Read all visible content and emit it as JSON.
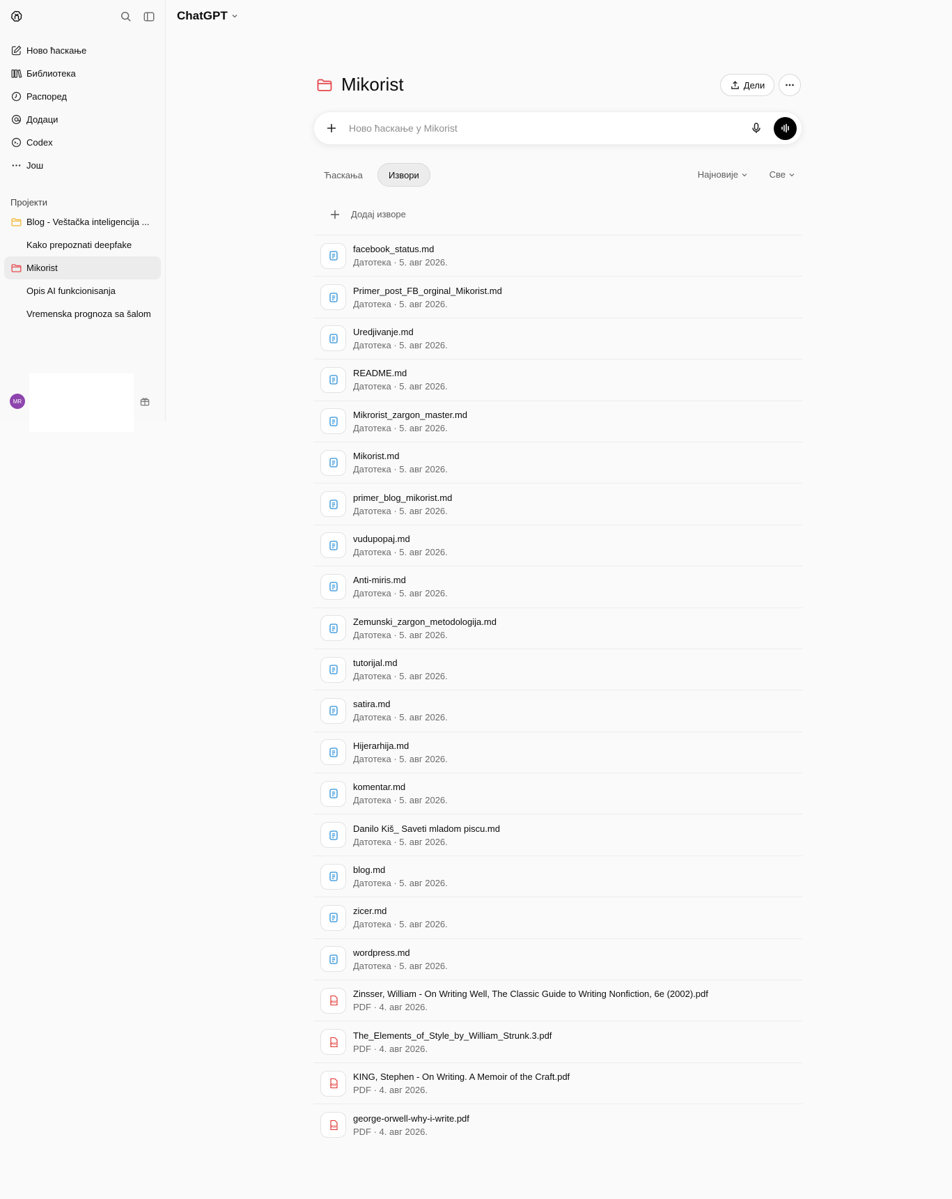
{
  "app": {
    "title": "ChatGPT"
  },
  "sidebar": {
    "nav": [
      {
        "label": "Ново ћаскање",
        "icon": "new-chat-icon"
      },
      {
        "label": "Библиотека",
        "icon": "library-icon"
      },
      {
        "label": "Распоред",
        "icon": "clock-icon"
      },
      {
        "label": "Додаци",
        "icon": "at-icon"
      },
      {
        "label": "Codex",
        "icon": "codex-icon"
      },
      {
        "label": "Још",
        "icon": "ellipsis-icon"
      }
    ],
    "projects_heading": "Пројекти",
    "projects": [
      {
        "label": "Blog - Veštačka inteligencija ...",
        "icon": "folder-icon",
        "level": 0,
        "active": false
      },
      {
        "label": "Kako prepoznati deepfake",
        "level": 1,
        "active": false
      },
      {
        "label": "Mikorist",
        "icon": "folder-icon",
        "level": 0,
        "active": true
      },
      {
        "label": "Opis AI funkcionisanja",
        "level": 1,
        "active": false
      },
      {
        "label": "Vremenska prognoza sa šalom",
        "level": 1,
        "active": false
      }
    ],
    "user_initials": "MR"
  },
  "project": {
    "title": "Mikorist",
    "share_label": "Дели",
    "composer_placeholder": "Ново ћаскање у Mikorist",
    "tabs": [
      "Ћаскања",
      "Извори"
    ],
    "active_tab": "Извори",
    "sort_label": "Најновије",
    "filter_label": "Све",
    "add_sources_label": "Додај изворе"
  },
  "colors": {
    "folder_active": "#e5484d",
    "folder_other": "#f2b731",
    "md_icon": "#2a8fd8",
    "pdf_icon": "#e02e2a"
  },
  "files": [
    {
      "name": "facebook_status.md",
      "meta": "Датотека · 5. авг 2026.",
      "type": "md"
    },
    {
      "name": "Primer_post_FB_orginal_Mikorist.md",
      "meta": "Датотека · 5. авг 2026.",
      "type": "md"
    },
    {
      "name": "Uredjivanje.md",
      "meta": "Датотека · 5. авг 2026.",
      "type": "md"
    },
    {
      "name": "README.md",
      "meta": "Датотека · 5. авг 2026.",
      "type": "md"
    },
    {
      "name": "Mikrorist_zargon_master.md",
      "meta": "Датотека · 5. авг 2026.",
      "type": "md"
    },
    {
      "name": "Mikorist.md",
      "meta": "Датотека · 5. авг 2026.",
      "type": "md"
    },
    {
      "name": "primer_blog_mikorist.md",
      "meta": "Датотека · 5. авг 2026.",
      "type": "md"
    },
    {
      "name": "vudupopaj.md",
      "meta": "Датотека · 5. авг 2026.",
      "type": "md"
    },
    {
      "name": "Anti-miris.md",
      "meta": "Датотека · 5. авг 2026.",
      "type": "md"
    },
    {
      "name": "Zemunski_zargon_metodologija.md",
      "meta": "Датотека · 5. авг 2026.",
      "type": "md"
    },
    {
      "name": "tutorijal.md",
      "meta": "Датотека · 5. авг 2026.",
      "type": "md"
    },
    {
      "name": "satira.md",
      "meta": "Датотека · 5. авг 2026.",
      "type": "md"
    },
    {
      "name": "Hijerarhija.md",
      "meta": "Датотека · 5. авг 2026.",
      "type": "md"
    },
    {
      "name": "komentar.md",
      "meta": "Датотека · 5. авг 2026.",
      "type": "md"
    },
    {
      "name": "Danilo Kiš_ Saveti mladom piscu.md",
      "meta": "Датотека · 5. авг 2026.",
      "type": "md"
    },
    {
      "name": "blog.md",
      "meta": "Датотека · 5. авг 2026.",
      "type": "md"
    },
    {
      "name": "zicer.md",
      "meta": "Датотека · 5. авг 2026.",
      "type": "md"
    },
    {
      "name": "wordpress.md",
      "meta": "Датотека · 5. авг 2026.",
      "type": "md"
    },
    {
      "name": "Zinsser, William - On Writing Well, The Classic Guide to Writing Nonfiction, 6e (2002).pdf",
      "meta": "PDF · 4. авг 2026.",
      "type": "pdf"
    },
    {
      "name": "The_Elements_of_Style_by_William_Strunk.3.pdf",
      "meta": "PDF · 4. авг 2026.",
      "type": "pdf"
    },
    {
      "name": "KING, Stephen - On Writing. A Memoir of the Craft.pdf",
      "meta": "PDF · 4. авг 2026.",
      "type": "pdf"
    },
    {
      "name": "george-orwell-why-i-write.pdf",
      "meta": "PDF · 4. авг 2026.",
      "type": "pdf"
    }
  ]
}
